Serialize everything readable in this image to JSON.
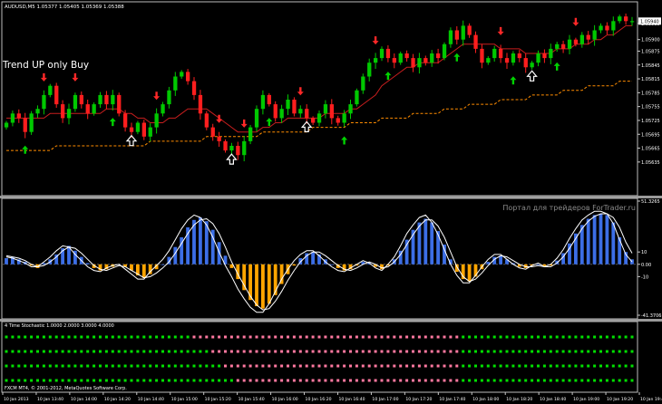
{
  "window": {
    "symbol_header": "AUDUSD,M5  1.05377 1.05405 1.05369 1.05388",
    "annotation": "Trend UP only Buy",
    "watermark": "Портал для трейдеров ForTrader.ru",
    "copyright": "FXCM MT4, © 2001-2012, MetaQuotes Software Corp."
  },
  "colors": {
    "background": "#000000",
    "bull": "#00c800",
    "bear": "#ff1e1e",
    "ma_fast": "#c81e1e",
    "ma_slow": "#ff8c00",
    "buy_arrow": "#00d200",
    "sell_arrow": "#ff2828",
    "osc_pos": "#3c6ee6",
    "osc_neg": "#ffa500",
    "dot_green": "#00e000",
    "dot_pink": "#ff78a0",
    "axis": "#c8c8c8"
  },
  "chart_data": [
    {
      "type": "candlestick",
      "title": "AUDUSD,M5  1.05377 1.05405 1.05369 1.05388",
      "ylim": [
        1.0557,
        1.0597
      ],
      "y_ticks": [
        "1.05935",
        "1.05900",
        "1.05875",
        "1.05845",
        "1.05815",
        "1.05785",
        "1.05755",
        "1.05725",
        "1.05695",
        "1.05665",
        "1.05635"
      ],
      "y_tick_values": [
        1.05935,
        1.059,
        1.05875,
        1.05845,
        1.05815,
        1.05785,
        1.05755,
        1.05725,
        1.05695,
        1.05665,
        1.05635
      ],
      "x_ticks": [
        "10 Jan 2013",
        "10 Jan 13:40",
        "10 Jan 14:00",
        "10 Jan 14:20",
        "10 Jan 14:40",
        "10 Jan 15:00",
        "10 Jan 15:20",
        "10 Jan 15:40",
        "10 Jan 16:00",
        "10 Jan 16:20",
        "10 Jan 16:40",
        "10 Jan 17:00",
        "10 Jan 17:20",
        "10 Jan 17:40",
        "10 Jan 18:00",
        "10 Jan 18:20",
        "10 Jan 18:40",
        "10 Jan 19:00",
        "10 Jan 19:20",
        "10 Jan 19:40"
      ],
      "close": [
        1.0572,
        1.0574,
        1.0573,
        1.057,
        1.0574,
        1.0575,
        1.0578,
        1.058,
        1.0576,
        1.0573,
        1.0575,
        1.0578,
        1.0576,
        1.0574,
        1.0576,
        1.0578,
        1.0576,
        1.0578,
        1.0574,
        1.0571,
        1.057,
        1.0572,
        1.0569,
        1.0571,
        1.0574,
        1.0576,
        1.0579,
        1.0582,
        1.0583,
        1.0581,
        1.0578,
        1.0574,
        1.0571,
        1.0569,
        1.0568,
        1.0566,
        1.0567,
        1.0565,
        1.0568,
        1.0571,
        1.0575,
        1.0578,
        1.0576,
        1.0573,
        1.0575,
        1.0577,
        1.0574,
        1.0575,
        1.0573,
        1.0572,
        1.0574,
        1.0576,
        1.0573,
        1.0572,
        1.0574,
        1.0576,
        1.0579,
        1.0582,
        1.0585,
        1.0586,
        1.0588,
        1.0586,
        1.0585,
        1.0587,
        1.0586,
        1.0584,
        1.0586,
        1.0585,
        1.0587,
        1.0586,
        1.0589,
        1.0592,
        1.059,
        1.0593,
        1.0591,
        1.0588,
        1.0585,
        1.0586,
        1.0588,
        1.0586,
        1.0585,
        1.0587,
        1.0586,
        1.0584,
        1.0585,
        1.0587,
        1.0586,
        1.0588,
        1.0589,
        1.0588,
        1.059,
        1.0589,
        1.0591,
        1.059,
        1.0592,
        1.0593,
        1.0592,
        1.0594,
        1.0595,
        1.0594,
        1.0594
      ],
      "ma_fast": [
        1.0573,
        1.0573,
        1.0573,
        1.0573,
        1.0573,
        1.0573,
        1.0573,
        1.0574,
        1.0574,
        1.0574,
        1.0574,
        1.0574,
        1.0574,
        1.0574,
        1.0574,
        1.0574,
        1.0575,
        1.0575,
        1.0575,
        1.0574,
        1.0574,
        1.0573,
        1.0573,
        1.0572,
        1.0572,
        1.0572,
        1.0573,
        1.0573,
        1.0574,
        1.0575,
        1.0575,
        1.0575,
        1.0575,
        1.0574,
        1.0573,
        1.0572,
        1.0571,
        1.057,
        1.057,
        1.057,
        1.057,
        1.0571,
        1.0571,
        1.0572,
        1.0572,
        1.0573,
        1.0573,
        1.0573,
        1.0573,
        1.0573,
        1.0573,
        1.0574,
        1.0574,
        1.0574,
        1.0574,
        1.0575,
        1.0575,
        1.0576,
        1.0577,
        1.0578,
        1.058,
        1.0581,
        1.0582,
        1.0583,
        1.0584,
        1.0584,
        1.0585,
        1.0585,
        1.0585,
        1.0585,
        1.0586,
        1.0587,
        1.0588,
        1.0589,
        1.0589,
        1.0589,
        1.0589,
        1.0589,
        1.0589,
        1.0588,
        1.0588,
        1.0588,
        1.0588,
        1.0587,
        1.0587,
        1.0587,
        1.0587,
        1.0587,
        1.0588,
        1.0588,
        1.0588,
        1.0589,
        1.0589,
        1.0589,
        1.059,
        1.059,
        1.0591,
        1.0591,
        1.0592,
        1.0593,
        1.0593
      ],
      "ma_slow": [
        1.0566,
        1.0566,
        1.0566,
        1.0566,
        1.0566,
        1.0566,
        1.0566,
        1.0566,
        1.0567,
        1.0567,
        1.0567,
        1.0567,
        1.0567,
        1.0567,
        1.0567,
        1.0567,
        1.0567,
        1.0567,
        1.0567,
        1.0567,
        1.0567,
        1.0567,
        1.0567,
        1.0568,
        1.0568,
        1.0568,
        1.0568,
        1.0568,
        1.0568,
        1.0568,
        1.0568,
        1.0568,
        1.0569,
        1.0569,
        1.0569,
        1.0569,
        1.0569,
        1.0569,
        1.0569,
        1.0569,
        1.0569,
        1.057,
        1.057,
        1.057,
        1.057,
        1.057,
        1.057,
        1.057,
        1.057,
        1.0571,
        1.0571,
        1.0571,
        1.0571,
        1.0571,
        1.0571,
        1.0572,
        1.0572,
        1.0572,
        1.0572,
        1.0572,
        1.0573,
        1.0573,
        1.0573,
        1.0573,
        1.0573,
        1.0574,
        1.0574,
        1.0574,
        1.0574,
        1.0574,
        1.0575,
        1.0575,
        1.0575,
        1.0575,
        1.0576,
        1.0576,
        1.0576,
        1.0576,
        1.0576,
        1.0577,
        1.0577,
        1.0577,
        1.0577,
        1.0577,
        1.0578,
        1.0578,
        1.0578,
        1.0578,
        1.0578,
        1.0579,
        1.0579,
        1.0579,
        1.0579,
        1.058,
        1.058,
        1.058,
        1.058,
        1.058,
        1.0581,
        1.0581,
        1.0581
      ],
      "buy_arrows": [
        3,
        17,
        42,
        54,
        61,
        72,
        81,
        88
      ],
      "sell_arrows": [
        6,
        11,
        24,
        34,
        38,
        47,
        59,
        79,
        91
      ],
      "hollow_up_arrows": [
        20,
        36,
        48,
        84
      ]
    },
    {
      "type": "histogram",
      "title": "",
      "ylim": [
        -41.37,
        51.33
      ],
      "y_ticks": [
        "51.3265",
        "10",
        "0.00",
        "-10",
        "-41.3706"
      ],
      "y_tick_values": [
        51.33,
        10,
        0,
        -10,
        -41.37
      ],
      "histogram": [
        5,
        6,
        4,
        2,
        -1,
        -3,
        1,
        4,
        8,
        13,
        15,
        11,
        6,
        1,
        -3,
        -5,
        -4,
        -2,
        0,
        -2,
        -5,
        -9,
        -11,
        -8,
        -4,
        0,
        6,
        14,
        22,
        30,
        36,
        38,
        35,
        28,
        18,
        7,
        -3,
        -12,
        -21,
        -29,
        -34,
        -36,
        -32,
        -25,
        -16,
        -8,
        -1,
        5,
        9,
        10,
        8,
        4,
        0,
        -3,
        -5,
        -4,
        -1,
        2,
        1,
        -2,
        -4,
        -1,
        4,
        11,
        20,
        28,
        34,
        37,
        34,
        27,
        16,
        4,
        -6,
        -12,
        -14,
        -10,
        -4,
        2,
        6,
        7,
        4,
        1,
        -2,
        -3,
        -1,
        0,
        -2,
        -1,
        3,
        9,
        17,
        25,
        32,
        37,
        40,
        41,
        40,
        34,
        22,
        10,
        4
      ],
      "signal_line": [
        7,
        6,
        5,
        3,
        0,
        -2,
        -1,
        2,
        6,
        11,
        14,
        13,
        9,
        4,
        -1,
        -4,
        -5,
        -3,
        -1,
        -2,
        -5,
        -8,
        -11,
        -10,
        -7,
        -3,
        2,
        9,
        17,
        25,
        32,
        36,
        37,
        33,
        25,
        14,
        2,
        -8,
        -17,
        -26,
        -33,
        -37,
        -36,
        -30,
        -22,
        -13,
        -5,
        2,
        7,
        10,
        10,
        7,
        3,
        -1,
        -4,
        -5,
        -3,
        0,
        2,
        0,
        -3,
        -2,
        2,
        8,
        16,
        24,
        31,
        36,
        36,
        31,
        22,
        10,
        -2,
        -10,
        -14,
        -12,
        -7,
        -1,
        4,
        7,
        6,
        3,
        0,
        -2,
        -2,
        -1,
        -2,
        -2,
        1,
        6,
        13,
        21,
        29,
        35,
        39,
        41,
        41,
        38,
        30,
        18,
        9
      ],
      "fast_line": [
        6,
        5,
        3,
        1,
        -2,
        -2,
        2,
        6,
        11,
        15,
        14,
        8,
        3,
        -2,
        -5,
        -6,
        -3,
        -1,
        0,
        -4,
        -8,
        -12,
        -12,
        -6,
        -1,
        4,
        11,
        20,
        29,
        36,
        40,
        38,
        32,
        22,
        10,
        -1,
        -10,
        -20,
        -28,
        -35,
        -39,
        -39,
        -32,
        -22,
        -12,
        -4,
        3,
        8,
        11,
        11,
        7,
        2,
        -2,
        -5,
        -6,
        -3,
        0,
        3,
        1,
        -3,
        -5,
        0,
        6,
        15,
        25,
        32,
        38,
        40,
        34,
        24,
        12,
        0,
        -9,
        -15,
        -15,
        -9,
        -2,
        4,
        8,
        8,
        4,
        0,
        -3,
        -4,
        -1,
        1,
        -2,
        0,
        5,
        12,
        21,
        29,
        36,
        40,
        43,
        43,
        41,
        33,
        20,
        8,
        2
      ]
    },
    {
      "type": "dots",
      "title": "4 Time Stochastic 1.0000 2.0000 3.0000 4.0000",
      "rows": [
        {
          "segments": [
            [
              "g",
              30
            ],
            [
              "p",
              43
            ],
            [
              "g",
              28
            ]
          ]
        },
        {
          "segments": [
            [
              "g",
              33
            ],
            [
              "p",
              40
            ],
            [
              "g",
              28
            ]
          ]
        },
        {
          "segments": [
            [
              "g",
              35
            ],
            [
              "p",
              38
            ],
            [
              "g",
              28
            ]
          ]
        },
        {
          "segments": [
            [
              "g",
              37
            ],
            [
              "p",
              36
            ],
            [
              "g",
              28
            ]
          ]
        }
      ]
    }
  ]
}
